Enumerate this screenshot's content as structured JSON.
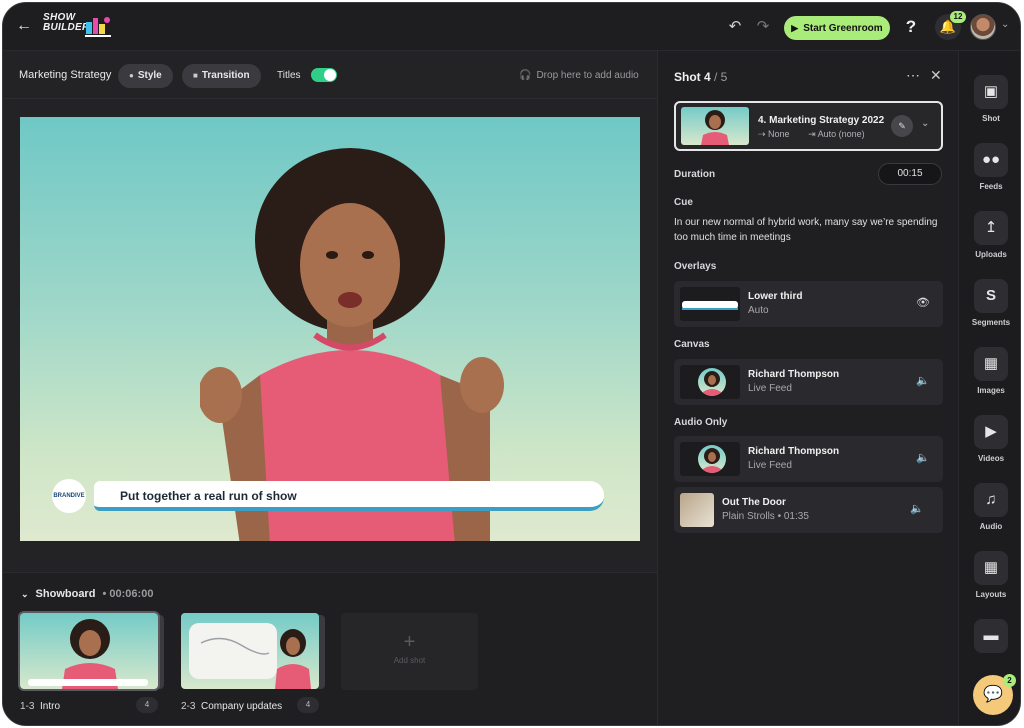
{
  "header": {
    "logo_text": "SHOW BUILDER",
    "start_greenroom_label": "Start Greenroom",
    "help_label": "?",
    "notifications_count": "12"
  },
  "toolbar": {
    "show_title": "Marketing Strategy",
    "style_label": "Style",
    "transition_label": "Transition",
    "titles_label": "Titles",
    "titles_on": true,
    "audio_drop_label": "Drop here to add audio"
  },
  "stage": {
    "logo_text": "BRANDIVE",
    "lower_third_text": "Put together a real run of show"
  },
  "showboard": {
    "title": "Showboard",
    "duration": "00:06:00",
    "shots": [
      {
        "index": "1-3",
        "name": "Intro",
        "count": "4"
      },
      {
        "index": "2-3",
        "name": "Company updates",
        "count": "4"
      }
    ],
    "add_label": "Add shot"
  },
  "panel": {
    "shot_label": "Shot 4",
    "shot_total": "/ 5",
    "shot_name": "4. Marketing Strategy 2022",
    "shot_in": "None",
    "shot_out": "Auto (none)",
    "duration_label": "Duration",
    "duration_value": "00:15",
    "cue_label": "Cue",
    "cue_text": "In our new normal of hybrid work, many say we’re spending too much time in meetings",
    "overlays_label": "Overlays",
    "overlay": {
      "name": "Lower third",
      "sub": "Auto"
    },
    "canvas_label": "Canvas",
    "canvas": {
      "name": "Richard Thompson",
      "sub": "Live Feed"
    },
    "audio_only_label": "Audio Only",
    "audio_feed": {
      "name": "Richard Thompson",
      "sub": "Live Feed"
    },
    "audio_track": {
      "name": "Out The Door",
      "sub": "Plain Strolls",
      "time": "01:35"
    }
  },
  "rail": {
    "items": [
      "Shot",
      "Feeds",
      "Uploads",
      "Segments",
      "Images",
      "Videos",
      "Audio",
      "Layouts"
    ],
    "chat_badge": "2"
  },
  "colors": {
    "accent_green": "#a9ec7a",
    "toggle_green": "#2fcf8a",
    "background": "#1c1c1f"
  }
}
